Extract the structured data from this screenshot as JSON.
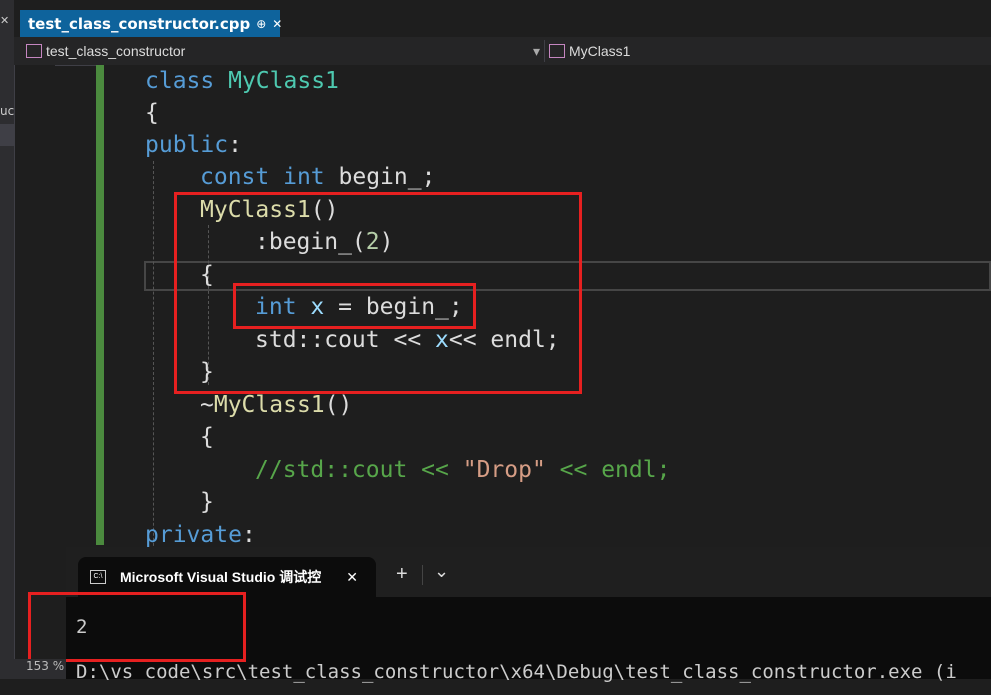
{
  "editor_tab": {
    "filename": "test_class_constructor.cpp",
    "pin_icon": "⊕",
    "close_icon": "✕"
  },
  "nav": {
    "project": "test_class_constructor",
    "scope": "MyClass1",
    "dropdown_icon": "▾"
  },
  "code": {
    "l1": {
      "kw": "class",
      "name": "MyClass1"
    },
    "l2": {
      "brace": "{"
    },
    "l3": {
      "kw": "public",
      "colon": ":"
    },
    "l4": {
      "kw1": "const",
      "kw2": "int",
      "rest": "begin_;"
    },
    "l5": {
      "fn": "MyClass1",
      "rest": "()"
    },
    "l6": {
      "pre": ":begin_(",
      "num": "2",
      "post": ")"
    },
    "l7": {
      "brace": "{"
    },
    "l8": {
      "kw": "int",
      "var": "x",
      "rest": "= begin_;"
    },
    "l9": {
      "pre": "std::cout << ",
      "var": "x",
      "post": "<< endl;"
    },
    "l10": {
      "brace": "}"
    },
    "l11": {
      "tilde": "~",
      "fn": "MyClass1",
      "rest": "()"
    },
    "l12": {
      "brace": "{"
    },
    "l13": {
      "pre": "//std::cout << ",
      "str": "\"Drop\"",
      "post": " << endl;"
    },
    "l14": {
      "brace": "}"
    },
    "l15": {
      "kw": "private",
      "colon": ":"
    }
  },
  "terminal": {
    "tab_title": "Microsoft Visual Studio 调试控",
    "close_icon": "✕",
    "new_tab_icon": "+",
    "dropdown_icon": "⌄",
    "output_line1": "2",
    "output_line2": "D:\\vs code\\src\\test_class_constructor\\x64\\Debug\\test_class_constructor.exe (i"
  },
  "left_panel": {
    "close": "✕",
    "text": "uc"
  },
  "status": {
    "zoom": "153 %"
  },
  "colors": {
    "accent_tab": "#0e639c",
    "highlight_box": "#e62020",
    "change_bar": "#4b8a3e"
  }
}
